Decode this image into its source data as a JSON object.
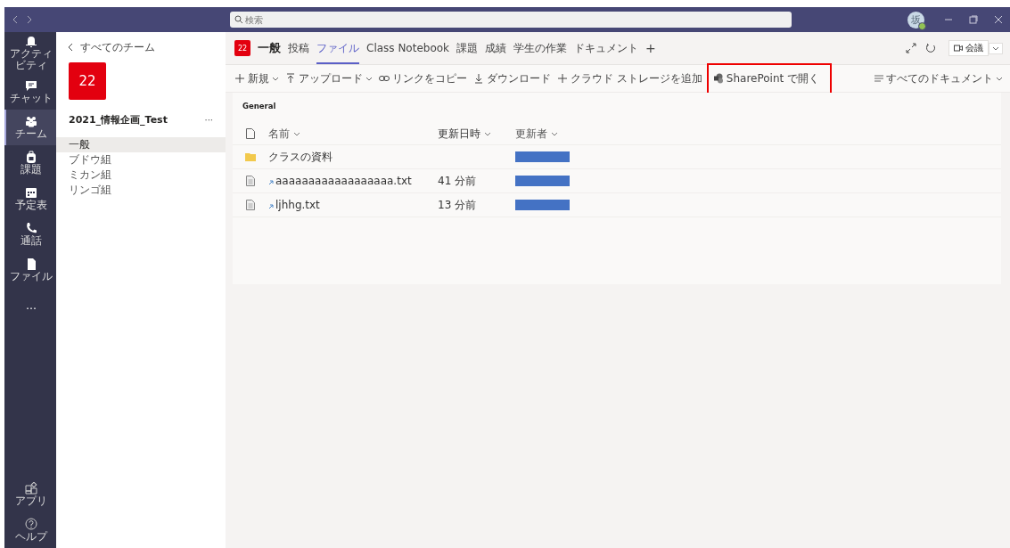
{
  "title_bar": {
    "search": {
      "placeholder": "検索"
    },
    "avatar": {
      "initial": "坂"
    }
  },
  "rail": {
    "items": [
      {
        "label": "アクティビティ",
        "kind": "bell",
        "selected": false
      },
      {
        "label": "チャット",
        "kind": "chat",
        "selected": false
      },
      {
        "label": "チーム",
        "kind": "teams",
        "selected": true
      },
      {
        "label": "課題",
        "kind": "bag",
        "selected": false
      },
      {
        "label": "予定表",
        "kind": "calendar",
        "selected": false
      },
      {
        "label": "通話",
        "kind": "phone",
        "selected": false
      },
      {
        "label": "ファイル",
        "kind": "file",
        "selected": false
      },
      {
        "label": "…",
        "kind": "more",
        "selected": false
      }
    ],
    "bottom": [
      {
        "label": "アプリ",
        "kind": "apps"
      },
      {
        "label": "ヘルプ",
        "kind": "help"
      }
    ]
  },
  "team_panel": {
    "back": "すべてのチーム",
    "tile": "22",
    "name": "2021_情報企画_Test",
    "more": "···",
    "channels": [
      {
        "label": "一般",
        "selected": true
      },
      {
        "label": "ブドウ組",
        "selected": false
      },
      {
        "label": "ミカン組",
        "selected": false
      },
      {
        "label": "リンゴ組",
        "selected": false
      }
    ]
  },
  "channel_header": {
    "tile": "22",
    "name": "一般",
    "tabs": [
      {
        "label": "投稿",
        "selected": false
      },
      {
        "label": "ファイル",
        "selected": true
      },
      {
        "label": "Class Notebook",
        "selected": false
      },
      {
        "label": "課題",
        "selected": false
      },
      {
        "label": "成績",
        "selected": false
      },
      {
        "label": "学生の作業",
        "selected": false
      },
      {
        "label": "ドキュメント",
        "selected": false
      }
    ],
    "add": "+",
    "meeting": "会議"
  },
  "toolbar": {
    "items": [
      {
        "label": "新規",
        "kind": "plus",
        "dropdown": true,
        "highlighted": false
      },
      {
        "label": "アップロード",
        "kind": "upload",
        "dropdown": true,
        "highlighted": false
      },
      {
        "label": "リンクをコピー",
        "kind": "link",
        "dropdown": false,
        "highlighted": false
      },
      {
        "label": "ダウンロード",
        "kind": "download",
        "dropdown": false,
        "highlighted": false
      },
      {
        "label": "クラウド ストレージを追加",
        "kind": "plus",
        "dropdown": false,
        "highlighted": false
      },
      {
        "label": "SharePoint で開く",
        "kind": "sharepoint",
        "dropdown": false,
        "highlighted": true
      }
    ],
    "view": "すべてのドキュメント"
  },
  "files": {
    "folder": "General",
    "columns": [
      "名前",
      "更新日時",
      "更新者"
    ],
    "rows": [
      {
        "kind": "folder",
        "name": "クラスの資料",
        "modified": ""
      },
      {
        "kind": "file",
        "name": "aaaaaaaaaaaaaaaaaa.txt",
        "modified": "41 分前"
      },
      {
        "kind": "file",
        "name": "ljhhg.txt",
        "modified": "13 分前"
      }
    ]
  }
}
